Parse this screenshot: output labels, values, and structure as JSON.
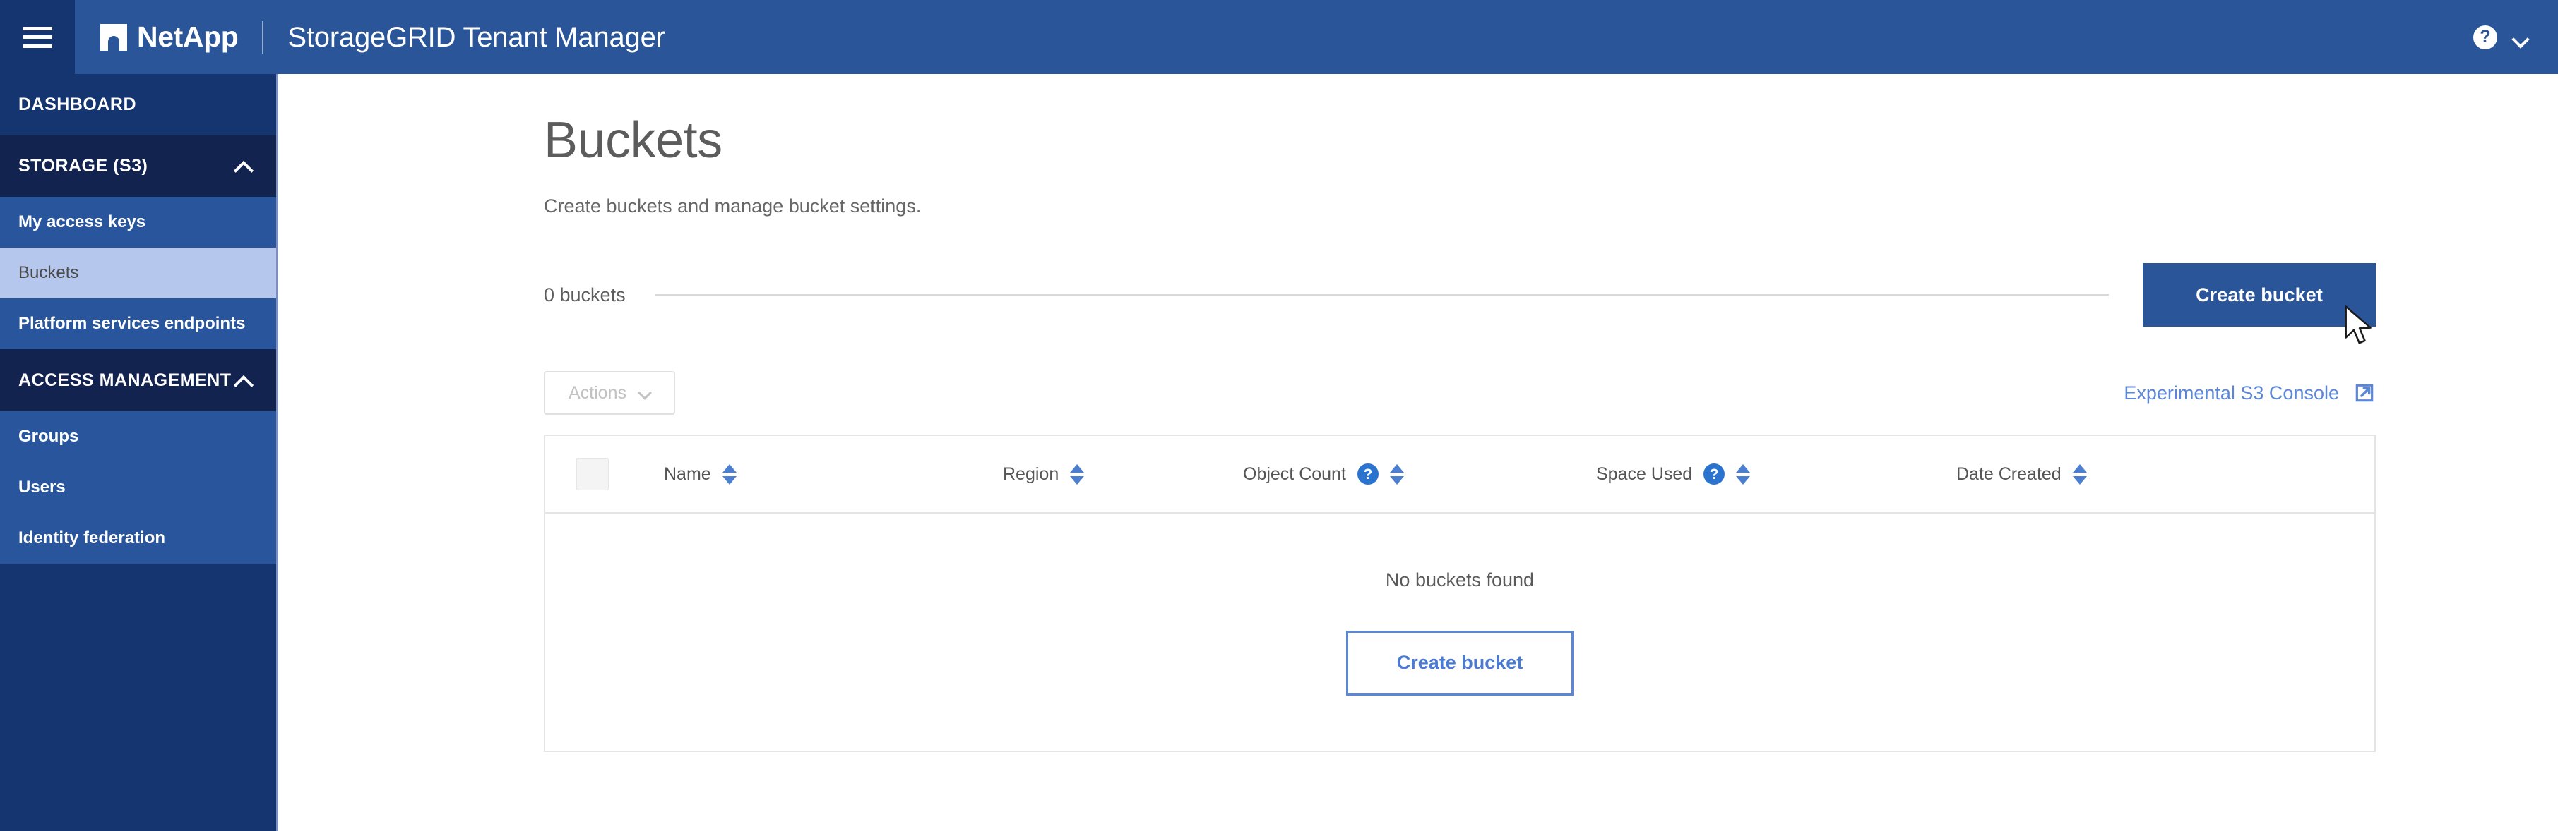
{
  "header": {
    "menu_icon": "hamburger-icon",
    "brand": "NetApp",
    "app_title": "StorageGRID Tenant Manager",
    "help_icon_label": "?",
    "account_chevron": "chevron-down-icon"
  },
  "sidebar": {
    "dashboard": "DASHBOARD",
    "sections": [
      {
        "label": "STORAGE (S3)",
        "expanded": true,
        "items": [
          {
            "label": "My access keys",
            "selected": false
          },
          {
            "label": "Buckets",
            "selected": true
          },
          {
            "label": "Platform services endpoints",
            "selected": false
          }
        ]
      },
      {
        "label": "ACCESS MANAGEMENT",
        "expanded": true,
        "items": [
          {
            "label": "Groups",
            "selected": false
          },
          {
            "label": "Users",
            "selected": false
          },
          {
            "label": "Identity federation",
            "selected": false
          }
        ]
      }
    ]
  },
  "page": {
    "title": "Buckets",
    "subtitle": "Create buckets and manage bucket settings.",
    "bucket_count_label": "0 buckets",
    "create_bucket_primary": "Create bucket"
  },
  "toolbar": {
    "actions_label": "Actions",
    "actions_disabled": true,
    "s3_console_link": "Experimental S3 Console",
    "s3_console_icon": "external-link-icon"
  },
  "table": {
    "columns": [
      {
        "label": "Name",
        "sortable": true,
        "help": false
      },
      {
        "label": "Region",
        "sortable": true,
        "help": false
      },
      {
        "label": "Object Count",
        "sortable": true,
        "help": true
      },
      {
        "label": "Space Used",
        "sortable": true,
        "help": true
      },
      {
        "label": "Date Created",
        "sortable": true,
        "help": false
      }
    ],
    "help_glyph": "?",
    "rows": [],
    "empty_message": "No buckets found",
    "empty_action_label": "Create bucket"
  },
  "colors": {
    "header_blue": "#2a5699",
    "header_dark_blue": "#153570",
    "sidebar_blue": "#153570",
    "sidebar_section": "#122350",
    "sidebar_item": "#28559c",
    "sidebar_selected": "#b5c7ed",
    "link_blue": "#5b87d6",
    "sort_arrow_blue": "#4d7fd0",
    "help_dot_blue": "#2a74d0"
  }
}
